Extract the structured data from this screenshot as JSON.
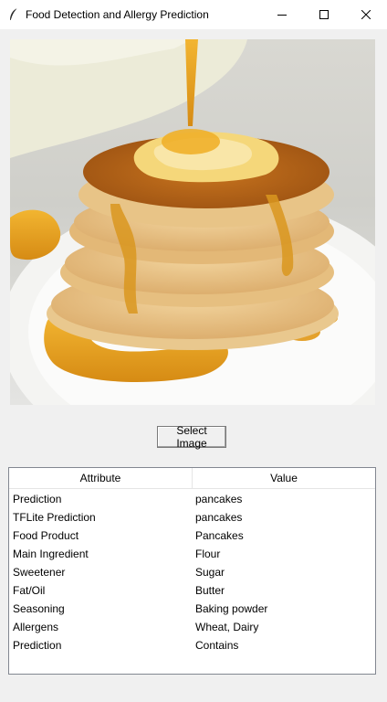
{
  "window": {
    "title": "Food Detection and Allergy Prediction",
    "controls": {
      "minimize": "minimize-icon",
      "maximize": "maximize-icon",
      "close": "close-icon"
    }
  },
  "image": {
    "description_icon": "pancakes-photo"
  },
  "select_button_label": "Select Image",
  "table": {
    "headers": {
      "attribute": "Attribute",
      "value": "Value"
    },
    "rows": [
      {
        "attribute": "Prediction",
        "value": "pancakes"
      },
      {
        "attribute": "TFLite Prediction",
        "value": "pancakes"
      },
      {
        "attribute": "Food Product",
        "value": "Pancakes"
      },
      {
        "attribute": "Main Ingredient",
        "value": "Flour"
      },
      {
        "attribute": "Sweetener",
        "value": "Sugar"
      },
      {
        "attribute": "Fat/Oil",
        "value": "Butter"
      },
      {
        "attribute": "Seasoning",
        "value": "Baking powder"
      },
      {
        "attribute": "Allergens",
        "value": "Wheat, Dairy"
      },
      {
        "attribute": "Prediction",
        "value": "Contains"
      }
    ]
  },
  "colors": {
    "syrup": "#e0a020",
    "pancake": "#e8c48a",
    "plate": "#ffffff"
  }
}
